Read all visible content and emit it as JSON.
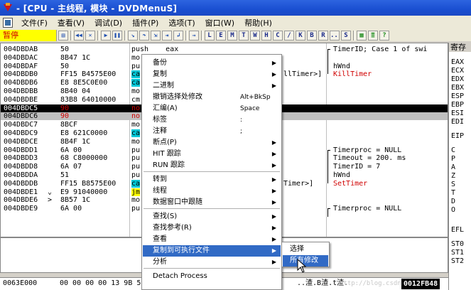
{
  "window": {
    "title": "- [CPU - 主线程, 模块 - DVDMenuS]"
  },
  "menubar": {
    "items": [
      "文件(F)",
      "查看(V)",
      "调试(D)",
      "插件(P)",
      "选项(T)",
      "窗口(W)",
      "帮助(H)"
    ]
  },
  "toolbar": {
    "status": "暂停",
    "icon_buttons": [
      "open-icon",
      "rewind-icon",
      "close-icon",
      "play-icon",
      "pause-icon",
      "step-into-icon",
      "step-over-icon",
      "trace-into-icon",
      "trace-over-icon",
      "execute-till-return-icon",
      "goto-icon"
    ],
    "letter_buttons": [
      "L",
      "E",
      "M",
      "T",
      "W",
      "H",
      "C",
      "/",
      "K",
      "B",
      "R",
      "...",
      "S"
    ],
    "extra_buttons": [
      "grid-icon",
      "list-icon",
      "help-icon"
    ]
  },
  "disasm": {
    "rows": [
      {
        "addr": "004DBDAB",
        "mark": " ",
        "hex": "50",
        "asm": "push    eax",
        "comment": "TimerID; Case 1 of swi"
      },
      {
        "addr": "004DBDAC",
        "mark": " ",
        "hex": "8B47 1C",
        "asm": "mo",
        "comment": ""
      },
      {
        "addr": "004DBDAF",
        "mark": " ",
        "hex": "50",
        "asm": "pu",
        "comment": "hWnd"
      },
      {
        "addr": "004DBDB0",
        "mark": " ",
        "hex": "FF15 B4575E00",
        "asm": "ca",
        "comment": "KillTimer"
      },
      {
        "addr": "004DBDB6",
        "mark": " ",
        "hex": "E8 8E5C0E00",
        "asm": "ca",
        "comment": ""
      },
      {
        "addr": "004DBDBB",
        "mark": " ",
        "hex": "8B40 04",
        "asm": "mo",
        "comment": ""
      },
      {
        "addr": "004DBDBE",
        "mark": " ",
        "hex": "83B8 64010000",
        "asm": "cm",
        "comment": ""
      },
      {
        "addr": "004DBDC5",
        "mark": " ",
        "hex": "90",
        "asm": "no",
        "comment": ""
      },
      {
        "addr": "004DBDC6",
        "mark": " ",
        "hex": "90",
        "asm": "no",
        "comment": ""
      },
      {
        "addr": "004DBDC7",
        "mark": " ",
        "hex": "8BCF",
        "asm": "mo",
        "comment": ""
      },
      {
        "addr": "004DBDC9",
        "mark": " ",
        "hex": "E8 621C0000",
        "asm": "ca",
        "comment": ""
      },
      {
        "addr": "004DBDCE",
        "mark": " ",
        "hex": "8B4F 1C",
        "asm": "mo",
        "comment": ""
      },
      {
        "addr": "004DBDD1",
        "mark": " ",
        "hex": "6A 00",
        "asm": "pu",
        "comment": "Timerproc = NULL"
      },
      {
        "addr": "004DBDD3",
        "mark": " ",
        "hex": "68 C8000000",
        "asm": "pu",
        "comment": "Timeout = 200. ms"
      },
      {
        "addr": "004DBDD8",
        "mark": " ",
        "hex": "6A 07",
        "asm": "pu",
        "comment": "TimerID = 7"
      },
      {
        "addr": "004DBDDA",
        "mark": " ",
        "hex": "51",
        "asm": "pu",
        "comment": "hWnd"
      },
      {
        "addr": "004DBDDB",
        "mark": " ",
        "hex": "FF15 B8575E00",
        "asm": "ca",
        "comment": "SetTimer"
      },
      {
        "addr": "004DBDE1",
        "mark": "⌄",
        "hex": "E9 91040000",
        "asm": "jm",
        "comment": ""
      },
      {
        "addr": "004DBDE6",
        "mark": ">",
        "hex": "8B57 1C",
        "asm": "mo",
        "comment": ""
      },
      {
        "addr": "004DBDE9",
        "mark": " ",
        "hex": "6A 00",
        "asm": "pu",
        "comment": "Timerproc = NULL"
      }
    ],
    "menu_shadow_tail_1": "llTimer>]",
    "menu_shadow_tail_2": "Timer>]"
  },
  "registers": {
    "header": "寄存",
    "names": [
      "EAX",
      "ECX",
      "EDX",
      "EBX",
      "ESP",
      "EBP",
      "ESI",
      "EDI",
      "EIP",
      "C",
      "P",
      "A",
      "Z",
      "S",
      "T",
      "D",
      "O",
      "EFL",
      "ST0",
      "ST1",
      "ST2"
    ]
  },
  "dump": {
    "addr": "0063E000",
    "hex": "00 00 00 00 13 9B 5",
    "ascii": "..渣.B渣.t渣.",
    "watermark": "http://blog.csdn.net/...",
    "badge": "0012FB48"
  },
  "context_menu": {
    "items": [
      {
        "label": "备份",
        "shortcut": "",
        "submenu": true
      },
      {
        "label": "复制",
        "shortcut": "",
        "submenu": true
      },
      {
        "label": "二进制",
        "shortcut": "",
        "submenu": true
      },
      {
        "label": "撤销选择处修改",
        "shortcut": "Alt+BkSp",
        "submenu": false
      },
      {
        "label": "汇编(A)",
        "shortcut": "Space",
        "submenu": false
      },
      {
        "label": "标签",
        "shortcut": ":",
        "submenu": false
      },
      {
        "label": "注释",
        "shortcut": ";",
        "submenu": false
      },
      {
        "label": "断点(P)",
        "shortcut": "",
        "submenu": true
      },
      {
        "label": "HIT 跟踪",
        "shortcut": "",
        "submenu": true
      },
      {
        "label": "RUN 跟踪",
        "shortcut": "",
        "submenu": true
      },
      {
        "label": "转到",
        "shortcut": "",
        "submenu": true
      },
      {
        "label": "线程",
        "shortcut": "",
        "submenu": true
      },
      {
        "label": "数据窗口中跟随",
        "shortcut": "",
        "submenu": true
      },
      {
        "label": "查找(S)",
        "shortcut": "",
        "submenu": true
      },
      {
        "label": "查找参考(R)",
        "shortcut": "",
        "submenu": true
      },
      {
        "label": "查看",
        "shortcut": "",
        "submenu": true
      },
      {
        "label": "复制到可执行文件",
        "shortcut": "",
        "submenu": true
      },
      {
        "label": "分析",
        "shortcut": "",
        "submenu": true
      },
      {
        "label": "Detach Process",
        "shortcut": "",
        "submenu": false
      }
    ]
  },
  "submenu": {
    "items": [
      "选择",
      "所有修改"
    ]
  }
}
